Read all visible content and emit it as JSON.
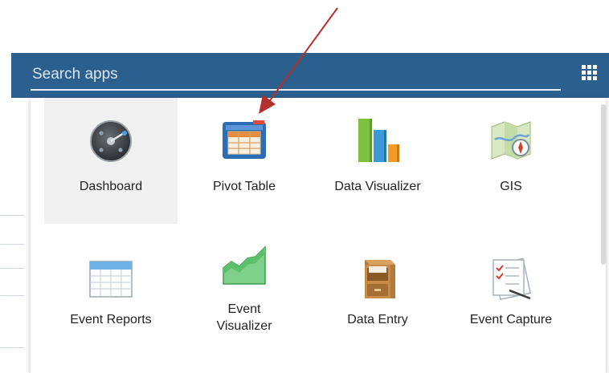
{
  "search": {
    "placeholder": "Search apps",
    "value": ""
  },
  "header": {
    "apps_menu_icon": "grid-icon"
  },
  "apps": [
    {
      "label": "Dashboard",
      "icon": "dashboard-icon",
      "active": true
    },
    {
      "label": "Pivot Table",
      "icon": "pivot-table-icon",
      "active": false
    },
    {
      "label": "Data Visualizer",
      "icon": "bar-chart-icon",
      "active": false
    },
    {
      "label": "GIS",
      "icon": "map-icon",
      "active": false
    },
    {
      "label": "Event Reports",
      "icon": "spreadsheet-icon",
      "active": false
    },
    {
      "label": "Event\nVisualizer",
      "icon": "area-chart-icon",
      "active": false
    },
    {
      "label": "Data Entry",
      "icon": "file-cabinet-icon",
      "active": false
    },
    {
      "label": "Event Capture",
      "icon": "checklist-icon",
      "active": false
    }
  ],
  "colors": {
    "header": "#2b5f8e",
    "arrow": "#b5302b",
    "active_tile": "#f1f1f1"
  }
}
